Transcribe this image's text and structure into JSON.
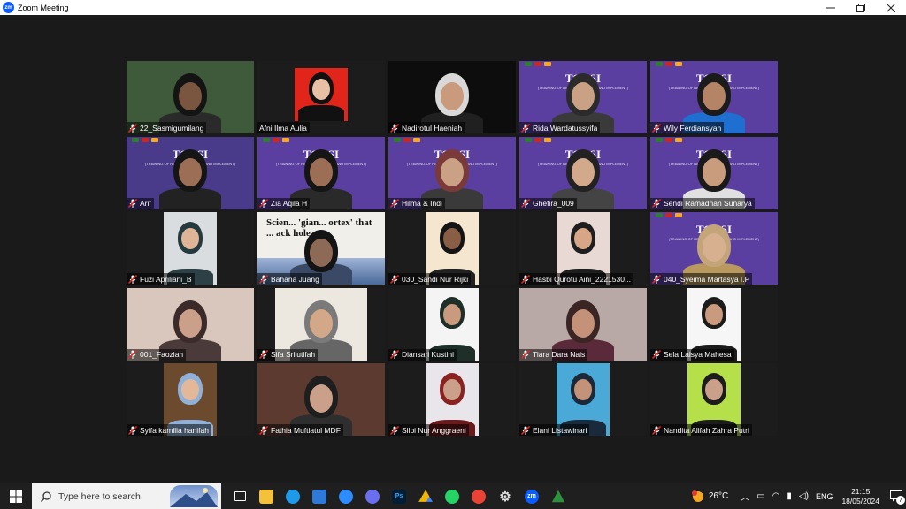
{
  "window": {
    "title": "Zoom Meeting",
    "logo_text": "zm"
  },
  "participants": [
    {
      "name": "22_Sasmigumilang",
      "muted": true,
      "kind": "camera",
      "bg": "#3e5a3a",
      "skin": "#7a5640",
      "hair": "#141414",
      "cloth": "#2a2a2a"
    },
    {
      "name": "Afni Ilma Aulia",
      "muted": false,
      "kind": "photo",
      "active": true,
      "bg": "#e1251b",
      "skin": "#e8c1a4",
      "hair": "#111111",
      "cloth": "#111111"
    },
    {
      "name": "Nadirotul Haeniah",
      "muted": true,
      "kind": "camera",
      "bg": "#0d0d0d",
      "skin": "#c99a7c",
      "hair": "#d8d8d8",
      "cloth": "#202020"
    },
    {
      "name": "Rida Wardatussyifa",
      "muted": true,
      "kind": "banner",
      "bg": "#5a3fa0",
      "skin": "#caa184",
      "hair": "#2b2b2b",
      "cloth": "#3a3a3a"
    },
    {
      "name": "Wily Ferdiansyah",
      "muted": true,
      "kind": "banner",
      "bg": "#5a3fa0",
      "skin": "#b58365",
      "hair": "#1b1b1b",
      "cloth": "#1f6fd1"
    },
    {
      "name": "Arif",
      "muted": true,
      "kind": "banner",
      "bg": "#4a3a8a",
      "skin": "#9b6e55",
      "hair": "#151515",
      "cloth": "#222222"
    },
    {
      "name": "Zia Aqila H",
      "muted": true,
      "kind": "banner",
      "bg": "#5a3fa0",
      "skin": "#9b6e55",
      "hair": "#151515",
      "cloth": "#2a2a2a"
    },
    {
      "name": "Hilma & Indi",
      "muted": true,
      "kind": "banner",
      "bg": "#5a3fa0",
      "skin": "#caa184",
      "hair": "#7a3a3a",
      "cloth": "#3a3a3a"
    },
    {
      "name": "Ghefira_009",
      "muted": true,
      "kind": "banner",
      "bg": "#5a3fa0",
      "skin": "#d2a98b",
      "hair": "#222222",
      "cloth": "#444444"
    },
    {
      "name": "Sendi Ramadhan Sunarya",
      "muted": true,
      "kind": "banner",
      "bg": "#5a3fa0",
      "skin": "#c99c7d",
      "hair": "#1a1a1a",
      "cloth": "#e0e0e0"
    },
    {
      "name": "Fuzi Apriliani_B",
      "muted": true,
      "kind": "portrait",
      "bg": "#d9dde0",
      "skin": "#e0b597",
      "hair": "#243a3e",
      "cloth": "#2c4045"
    },
    {
      "name": "Bahana Juang",
      "muted": true,
      "kind": "article",
      "bg": "#f1efea",
      "skin": "#8d6a55",
      "hair": "#141414",
      "cloth": "#3a4a66"
    },
    {
      "name": "030_Sandi Nur Rijki",
      "muted": true,
      "kind": "portrait",
      "bg": "#f4e6cf",
      "skin": "#8a5e45",
      "hair": "#141414",
      "cloth": "#222222"
    },
    {
      "name": "Hasbi Qurotu Aini_2221530...",
      "muted": true,
      "kind": "portrait",
      "bg": "#e9d9d5",
      "skin": "#d7a687",
      "hair": "#1e1e1e",
      "cloth": "#1e1e1e"
    },
    {
      "name": "040_Syeima Martasya I.P",
      "muted": true,
      "kind": "banner",
      "bg": "#5a3fa0",
      "skin": "#d7b090",
      "hair": "#c4a57a",
      "cloth": "#b9995e"
    },
    {
      "name": "001_Faoziah",
      "muted": true,
      "kind": "camera",
      "bg": "#d9c7bd",
      "skin": "#caa08a",
      "hair": "#3a2a2a",
      "cloth": "#4a3a3a"
    },
    {
      "name": "Sifa Srilutifah",
      "muted": true,
      "kind": "portrait-wide",
      "bg": "#ece8e0",
      "skin": "#d3a888",
      "hair": "#7a7a7a",
      "cloth": "#666666"
    },
    {
      "name": "Diansari Kustini",
      "muted": true,
      "kind": "portrait",
      "bg": "#f4f4f4",
      "skin": "#c99a7d",
      "hair": "#1e2f2a",
      "cloth": "#1e2f2a"
    },
    {
      "name": "Tiara Dara Nais",
      "muted": true,
      "kind": "camera",
      "bg": "#b8a8a6",
      "skin": "#c49278",
      "hair": "#3a2424",
      "cloth": "#5a2a3a"
    },
    {
      "name": "Sela Laisya Mahesa",
      "muted": true,
      "kind": "portrait",
      "bg": "#f6f6f6",
      "skin": "#c99a7d",
      "hair": "#1b1b1b",
      "cloth": "#1b1b1b"
    },
    {
      "name": "Syifa kamilia hanifah",
      "muted": true,
      "kind": "portrait",
      "bg": "#6b4a2e",
      "skin": "#e3b899",
      "hair": "#8fb0d8",
      "cloth": "#8fb0d8"
    },
    {
      "name": "Fathia Muftiatul MDF",
      "muted": true,
      "kind": "camera",
      "bg": "#5c3a30",
      "skin": "#caa08a",
      "hair": "#1e1e1e",
      "cloth": "#2e2e2e"
    },
    {
      "name": "Silpi Nur Anggraeni",
      "muted": true,
      "kind": "portrait",
      "bg": "#e8e6ea",
      "skin": "#caa08a",
      "hair": "#8a2222",
      "cloth": "#6a1a1a"
    },
    {
      "name": "Elani Listawinari",
      "muted": true,
      "kind": "portrait",
      "bg": "#4aa9d6",
      "skin": "#c49278",
      "hair": "#1a2a3a",
      "cloth": "#1a2a3a"
    },
    {
      "name": "Nandita Alifah Zahra Putri",
      "muted": true,
      "kind": "portrait",
      "bg": "#b6e04a",
      "skin": "#caa08a",
      "hair": "#1c1c1c",
      "cloth": "#1c1c1c"
    }
  ],
  "banner": {
    "title": "TORSI",
    "subtitle": "(TRAINING OF RESEARCH, STUDY, AND IMPLEMENT)"
  },
  "article_text": "Scien... 'gian... ortex' that ... ack hole",
  "taskbar": {
    "search_placeholder": "Type here to search",
    "apps": [
      {
        "icon": "task-view-icon",
        "color": "#ffffff"
      },
      {
        "icon": "file-explorer-icon",
        "color": "#f3c13a"
      },
      {
        "icon": "edge-icon",
        "color": "#1e9be8"
      },
      {
        "icon": "mail-icon",
        "color": "#2f7ad8"
      },
      {
        "icon": "zoom-video-icon",
        "color": "#2d8cff"
      },
      {
        "icon": "copilot-icon",
        "color": "#6a6ff2"
      },
      {
        "icon": "photoshop-icon",
        "color": "#001e36",
        "label": "Ps"
      },
      {
        "icon": "google-drive-icon",
        "color": "#34a853"
      },
      {
        "icon": "whatsapp-icon",
        "color": "#25d366"
      },
      {
        "icon": "chrome-icon",
        "color": "#ea4335"
      },
      {
        "icon": "settings-icon",
        "color": "#cfcfcf"
      },
      {
        "icon": "zoom-app-icon",
        "color": "#0b5cff",
        "label": "zm"
      },
      {
        "icon": "terminal-icon",
        "color": "#22a64a"
      }
    ],
    "weather_temp": "26°C",
    "language": "ENG",
    "time": "21:15",
    "date": "18/05/2024",
    "notification_count": "7"
  }
}
